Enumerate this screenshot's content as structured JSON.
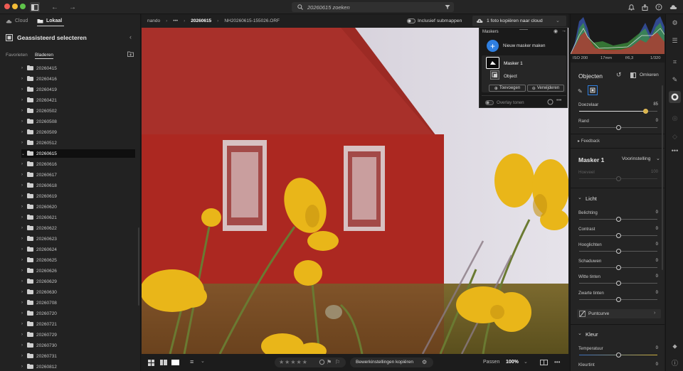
{
  "topbar": {
    "search_text": "20260615 zoeken"
  },
  "left": {
    "tab_cloud": "Cloud",
    "tab_local": "Lokaal",
    "title": "Geassisteerd selecteren",
    "subtab_favorites": "Favorieten",
    "subtab_browse": "Bladeren",
    "folders": [
      "20260415",
      "20260416",
      "20260419",
      "20260421",
      "20260502",
      "20260508",
      "20260509",
      "20260512",
      "20260615",
      "20260616",
      "20260617",
      "20260618",
      "20260619",
      "20260620",
      "20260621",
      "20260622",
      "20260623",
      "20260624",
      "20260625",
      "20260626",
      "20260629",
      "20260630",
      "20260708",
      "20260720",
      "20260721",
      "20260729",
      "20260730",
      "20260731",
      "20260812"
    ],
    "selected_folder": "20260615"
  },
  "breadcrumb": {
    "root": "nando",
    "ellipsis": "•••",
    "folder": "20260615",
    "file": "NH20260615-155026.ORF",
    "include_subfolders": "Inclusief submappen",
    "copy_to_cloud": "1 foto kopiëren naar cloud"
  },
  "masks_panel": {
    "title": "Maskers",
    "new_mask": "Nieuw masker maken",
    "mask1": "Masker 1",
    "object": "Object",
    "add": "Toevoegen",
    "remove": "Verwijderen",
    "overlay": "Overlay tonen"
  },
  "bottombar": {
    "copy_settings": "Bewerkinstellingen kopiëren",
    "fit": "Passen",
    "zoom": "100%"
  },
  "right": {
    "iso": "ISO 200",
    "focal": "17mm",
    "aperture": "f/6,3",
    "shutter": "1/320",
    "objects_title": "Objecten",
    "invert": "Omkeren",
    "brush_label": "Doezelaar",
    "brush_value": "85",
    "brush_fraction": 0.85,
    "edge_label": "Rand",
    "edge_value": "0",
    "feedback": "Feedback",
    "mask_title": "Masker 1",
    "preset": "Voorinstelling",
    "amount_label": "Hoeveel",
    "amount_value": "100",
    "light_title": "Licht",
    "light_sliders": [
      {
        "label": "Belichting",
        "value": "0"
      },
      {
        "label": "Contrast",
        "value": "0"
      },
      {
        "label": "Hooglichten",
        "value": "0"
      },
      {
        "label": "Schaduwen",
        "value": "0"
      },
      {
        "label": "Witte tinten",
        "value": "0"
      },
      {
        "label": "Zwarte tinten",
        "value": "0"
      }
    ],
    "point_curve": "Puntcurve",
    "color_title": "Kleur",
    "temperature": "Temperatuur",
    "temperature_value": "0",
    "tint": "Kleurtint",
    "tint_value": "0"
  },
  "colors": {
    "accent": "#2f7fe0",
    "mask_overlay": "#c0281f",
    "flower": "#e9b619"
  }
}
